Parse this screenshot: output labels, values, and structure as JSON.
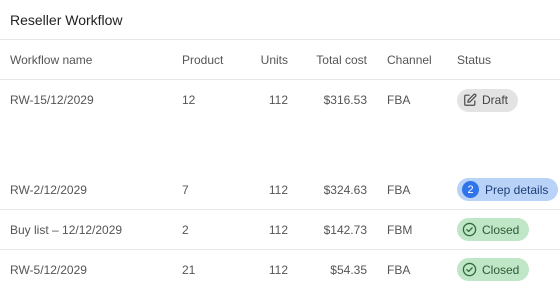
{
  "card": {
    "title": "Reseller Workflow"
  },
  "table": {
    "headers": {
      "workflow_name": "Workflow name",
      "product": "Product",
      "units": "Units",
      "total_cost": "Total cost",
      "channel": "Channel",
      "status": "Status"
    },
    "rows": [
      {
        "workflow_name": "RW-15/12/2029",
        "product": "12",
        "units": "112",
        "total_cost": "$316.53",
        "channel": "FBA",
        "status": {
          "label": "Draft",
          "type": "draft",
          "icon": "edit-icon",
          "color": "#e3e3e3"
        }
      },
      {
        "workflow_name": "RW-2/12/2029",
        "product": "7",
        "units": "112",
        "total_cost": "$324.63",
        "channel": "FBA",
        "status": {
          "label": "Prep details",
          "type": "prep",
          "count": "2",
          "color": "#b8d3f7",
          "count_color": "#2f74ea"
        }
      },
      {
        "workflow_name": "Buy list – 12/12/2029",
        "product": "2",
        "units": "112",
        "total_cost": "$142.73",
        "channel": "FBM",
        "status": {
          "label": "Closed",
          "type": "closed",
          "icon": "check-circle-icon",
          "color": "#bfe6c6"
        }
      },
      {
        "workflow_name": "RW-5/12/2029",
        "product": "21",
        "units": "112",
        "total_cost": "$54.35",
        "channel": "FBA",
        "status": {
          "label": "Closed",
          "type": "closed",
          "icon": "check-circle-icon",
          "color": "#bfe6c6"
        }
      }
    ]
  }
}
